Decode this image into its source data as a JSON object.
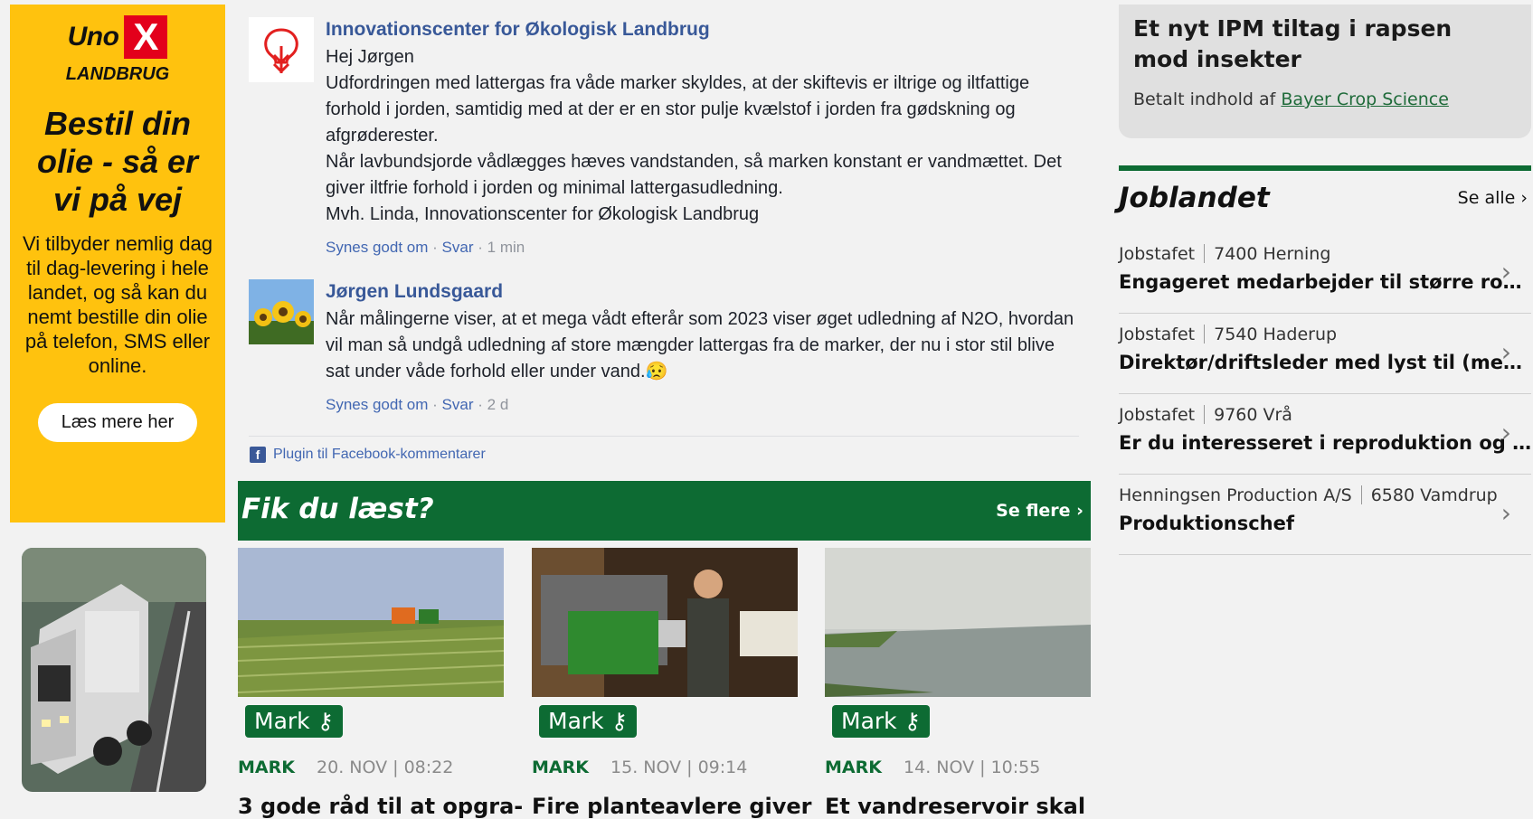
{
  "ad": {
    "brand": "Uno",
    "brand_x": "X",
    "sub": "LANDBRUG",
    "headline": "Bestil din olie - så er vi på vej",
    "body": "Vi tilbyder nemlig dag til dag-levering i hele landet, og så kan du nemt bestille din olie på telefon, SMS eller online.",
    "button": "Læs mere her"
  },
  "comments": [
    {
      "author": "Innovationscenter for Økologisk Landbrug",
      "lines": [
        "Hej Jørgen",
        "Udfordringen med lattergas fra våde marker skyldes, at der skiftevis er iltrige og iltfattige forhold i jorden, samtidig med at der er en stor pulje kvælstof i jorden fra gødskning og afgrøderester.",
        "Når lavbundsjorde vådlægges hæves vandstanden, så marken konstant er vandmættet. Det giver iltfrie forhold i jorden og minimal lattergasudledning.",
        "Mvh. Linda, Innovationscenter for Økologisk Landbrug"
      ],
      "like": "Synes godt om",
      "reply": "Svar",
      "time": "1 min"
    },
    {
      "author": "Jørgen Lundsgaard",
      "lines": [
        "Når målingerne viser, at et mega vådt efterår som 2023 viser øget udledning af N2O, hvordan vil man så undgå udledning af store mængder lattergas fra de marker, der nu i stor stil blive sat under våde forhold eller under vand.😥"
      ],
      "like": "Synes godt om",
      "reply": "Svar",
      "time": "2 d"
    }
  ],
  "dot": "·",
  "fb_plugin": "Plugin til Facebook-kommentarer",
  "fik": {
    "title": "Fik du læst?",
    "more": "Se flere ›"
  },
  "cards": [
    {
      "tag": "Mark",
      "category": "MARK",
      "date": "20. NOV | 08:22",
      "title": "3 gode råd til at opgra-"
    },
    {
      "tag": "Mark",
      "category": "MARK",
      "date": "15. NOV | 09:14",
      "title": "Fire planteavlere giver"
    },
    {
      "tag": "Mark",
      "category": "MARK",
      "date": "14. NOV | 10:55",
      "title": "Et vandreservoir skal"
    }
  ],
  "sponsor": {
    "title": "Et nyt IPM tiltag i rapsen mod insekter",
    "by_label": "Betalt indhold af",
    "by_link": "Bayer Crop Science"
  },
  "joblandet": {
    "title": "Joblandet",
    "see_all": "Se alle ›",
    "jobs": [
      {
        "company": "Jobstafet",
        "location": "7400 Herning",
        "title": "Engageret medarbejder til større ro…"
      },
      {
        "company": "Jobstafet",
        "location": "7540 Haderup",
        "title": "Direktør/driftsleder med lyst til (me…"
      },
      {
        "company": "Jobstafet",
        "location": "9760 Vrå",
        "title": "Er du interesseret i reproduktion og …"
      },
      {
        "company": "Henningsen Production A/S",
        "location": "6580 Vamdrup",
        "title": "Produktionschef"
      }
    ]
  },
  "colors": {
    "brand_green": "#0d6b33",
    "fb_link": "#385898",
    "ad_yellow": "#ffc20e"
  },
  "icons": {
    "key": "key-icon",
    "chevron": "chevron-right-icon",
    "facebook": "facebook-icon"
  }
}
